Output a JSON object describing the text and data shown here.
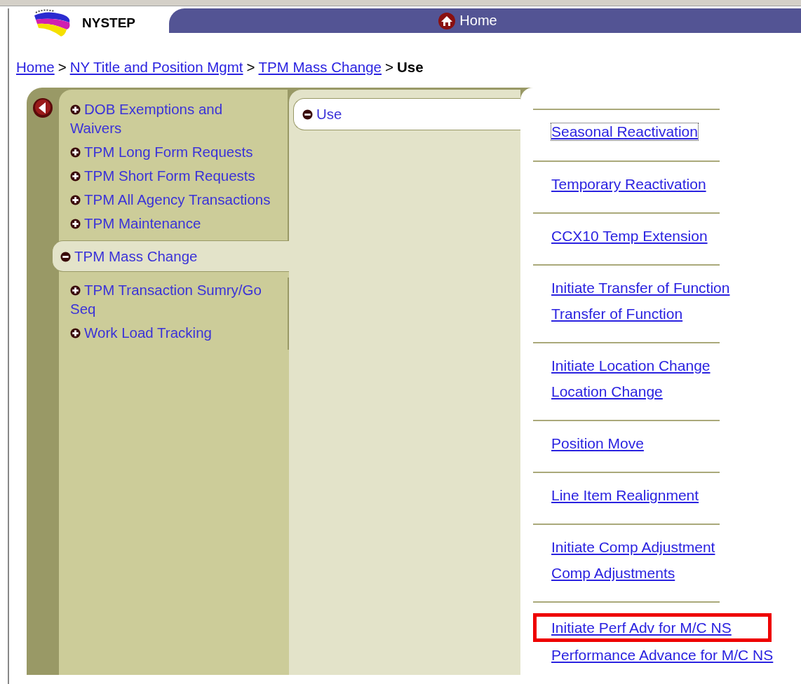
{
  "header": {
    "logo_text": "NYSTEP",
    "home_link": "Home"
  },
  "breadcrumb": [
    {
      "kind": "link",
      "label": "Home"
    },
    {
      "kind": "separator",
      "label": ">"
    },
    {
      "kind": "link",
      "label": "NY Title and Position Mgmt"
    },
    {
      "kind": "separator",
      "label": ">"
    },
    {
      "kind": "link",
      "label": "TPM Mass Change"
    },
    {
      "kind": "separator",
      "label": ">"
    },
    {
      "kind": "current",
      "label": "Use"
    }
  ],
  "menu": [
    {
      "label": "DOB Exemptions and Waivers",
      "expanded": false
    },
    {
      "label": "TPM Long Form Requests",
      "expanded": false
    },
    {
      "label": "TPM Short Form Requests",
      "expanded": false
    },
    {
      "label": "TPM All Agency Transactions",
      "expanded": false
    },
    {
      "label": "TPM Maintenance",
      "expanded": false
    },
    {
      "label": "TPM Mass Change",
      "expanded": true
    },
    {
      "label": "TPM Transaction Sumry/Go Seq",
      "expanded": false
    },
    {
      "label": "Work Load Tracking",
      "expanded": false
    }
  ],
  "submenu": [
    {
      "label": "Use",
      "expanded": true
    }
  ],
  "link_groups": [
    {
      "links": [
        {
          "label": "Seasonal Reactivation",
          "focused": true,
          "highlighted": false
        }
      ]
    },
    {
      "links": [
        {
          "label": "Temporary Reactivation",
          "focused": false,
          "highlighted": false
        }
      ]
    },
    {
      "links": [
        {
          "label": "CCX10 Temp Extension",
          "focused": false,
          "highlighted": false
        }
      ]
    },
    {
      "links": [
        {
          "label": "Initiate Transfer of Function",
          "focused": false,
          "highlighted": false
        },
        {
          "label": "Transfer of Function",
          "focused": false,
          "highlighted": false
        }
      ]
    },
    {
      "links": [
        {
          "label": "Initiate Location Change",
          "focused": false,
          "highlighted": false
        },
        {
          "label": "Location Change",
          "focused": false,
          "highlighted": false
        }
      ]
    },
    {
      "links": [
        {
          "label": "Position Move",
          "focused": false,
          "highlighted": false
        }
      ]
    },
    {
      "links": [
        {
          "label": "Line Item Realignment",
          "focused": false,
          "highlighted": false
        }
      ]
    },
    {
      "links": [
        {
          "label": "Initiate Comp Adjustment",
          "focused": false,
          "highlighted": false
        },
        {
          "label": "Comp Adjustments",
          "focused": false,
          "highlighted": false
        }
      ]
    },
    {
      "links": [
        {
          "label": "Initiate Perf Adv for M/C NS",
          "focused": false,
          "highlighted": true
        },
        {
          "label": "Performance Advance for M/C NS",
          "focused": false,
          "highlighted": false
        }
      ]
    }
  ]
}
